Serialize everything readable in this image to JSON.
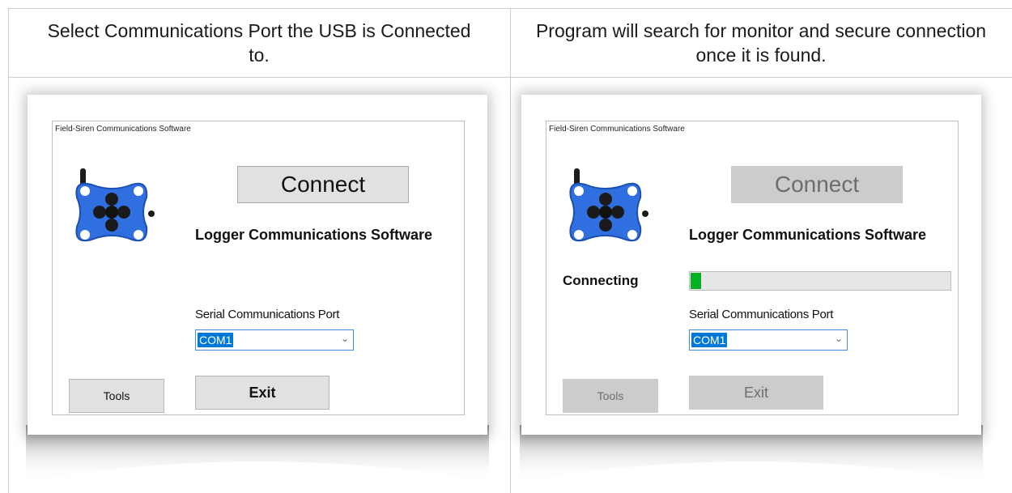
{
  "headers": {
    "left": "Select Communications Port the USB is Connected to.",
    "right": "Program will search for monitor and secure connection once it is found."
  },
  "panels": [
    {
      "window_title": "Field-Siren Communications Software",
      "connect_label": "Connect",
      "subtitle": "Logger Communications Software",
      "port_label": "Serial Communications Port",
      "port_value": "COM1",
      "tools_label": "Tools",
      "exit_label": "Exit"
    },
    {
      "window_title": "Field-Siren Communications Software",
      "connect_label": "Connect",
      "subtitle": "Logger Communications Software",
      "status": "Connecting",
      "progress": 0.04,
      "port_label": "Serial Communications Port",
      "port_value": "COM1",
      "tools_label": "Tools",
      "exit_label": "Exit"
    }
  ],
  "colors": {
    "device_body": "#2f6fe0",
    "progress_fill": "#06b025",
    "selection": "#0078d7"
  },
  "icons": [
    "logger-device-icon",
    "antenna-icon",
    "chevron-down-icon"
  ]
}
